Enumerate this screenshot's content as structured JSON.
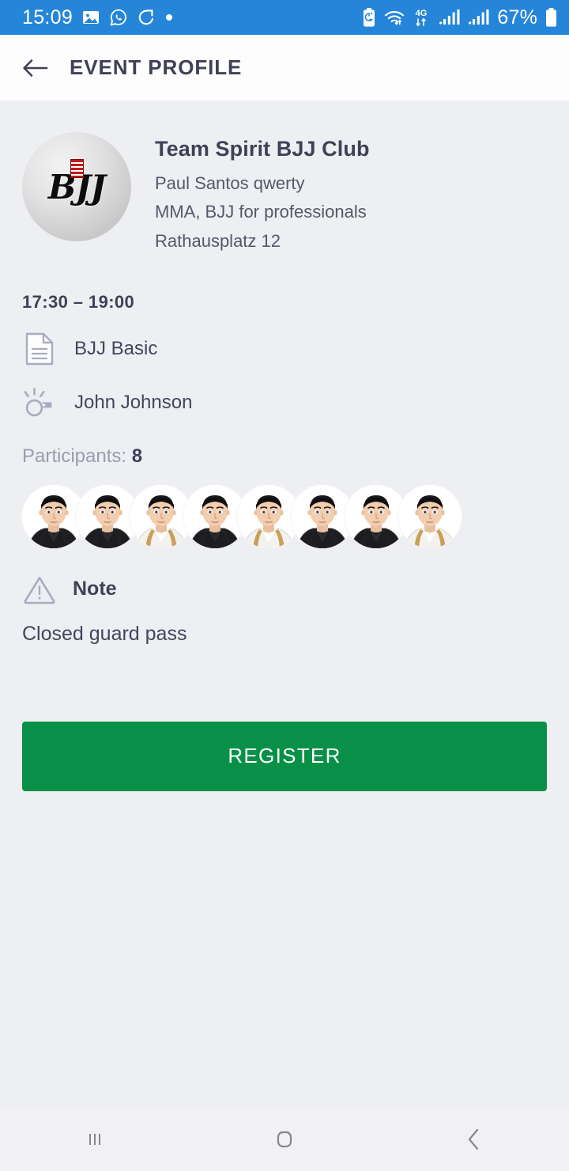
{
  "statusbar": {
    "time": "15:09",
    "battery_pct": "67%",
    "network": "4G",
    "icons": [
      "gallery-icon",
      "whatsapp-icon",
      "sync-icon",
      "dot-icon",
      "battery-saver-icon",
      "wifi-icon",
      "4g-icon",
      "signal-icon-1",
      "signal-icon-2",
      "battery-icon"
    ],
    "bg_color": "#2585d8"
  },
  "appbar": {
    "back_label": "back-arrow",
    "title": "EVENT PROFILE",
    "bg_color": "#fdfdfd",
    "title_color": "#3f4156"
  },
  "club": {
    "logo_text": "BJJ",
    "name": "Team Spirit BJJ Club",
    "owner": "Paul Santos qwerty",
    "description": "MMA, BJJ for professionals",
    "address": "Rathausplatz 12"
  },
  "event": {
    "time_range": "17:30 – 19:00",
    "class_name": "BJJ Basic",
    "class_icon": "document-icon",
    "coach_name": "John Johnson",
    "coach_icon": "whistle-icon",
    "participants_label": "Participants:",
    "participants_count": "8",
    "participant_avatars": [
      {
        "gi": "black"
      },
      {
        "gi": "black"
      },
      {
        "gi": "white"
      },
      {
        "gi": "black"
      },
      {
        "gi": "white"
      },
      {
        "gi": "black"
      },
      {
        "gi": "black"
      },
      {
        "gi": "white"
      }
    ]
  },
  "note": {
    "icon": "warning-triangle-icon",
    "label": "Note",
    "text": "Closed guard pass"
  },
  "action": {
    "register_label": "REGISTER",
    "register_color": "#099048"
  },
  "navbar": {
    "recents_label": "recents-icon",
    "home_label": "home-icon",
    "back_label": "back-icon"
  },
  "theme": {
    "page_bg": "#eeeff2",
    "text_dark": "#3f4156",
    "text_muted": "#9a9db0",
    "icon_gray": "#a9acc0"
  }
}
